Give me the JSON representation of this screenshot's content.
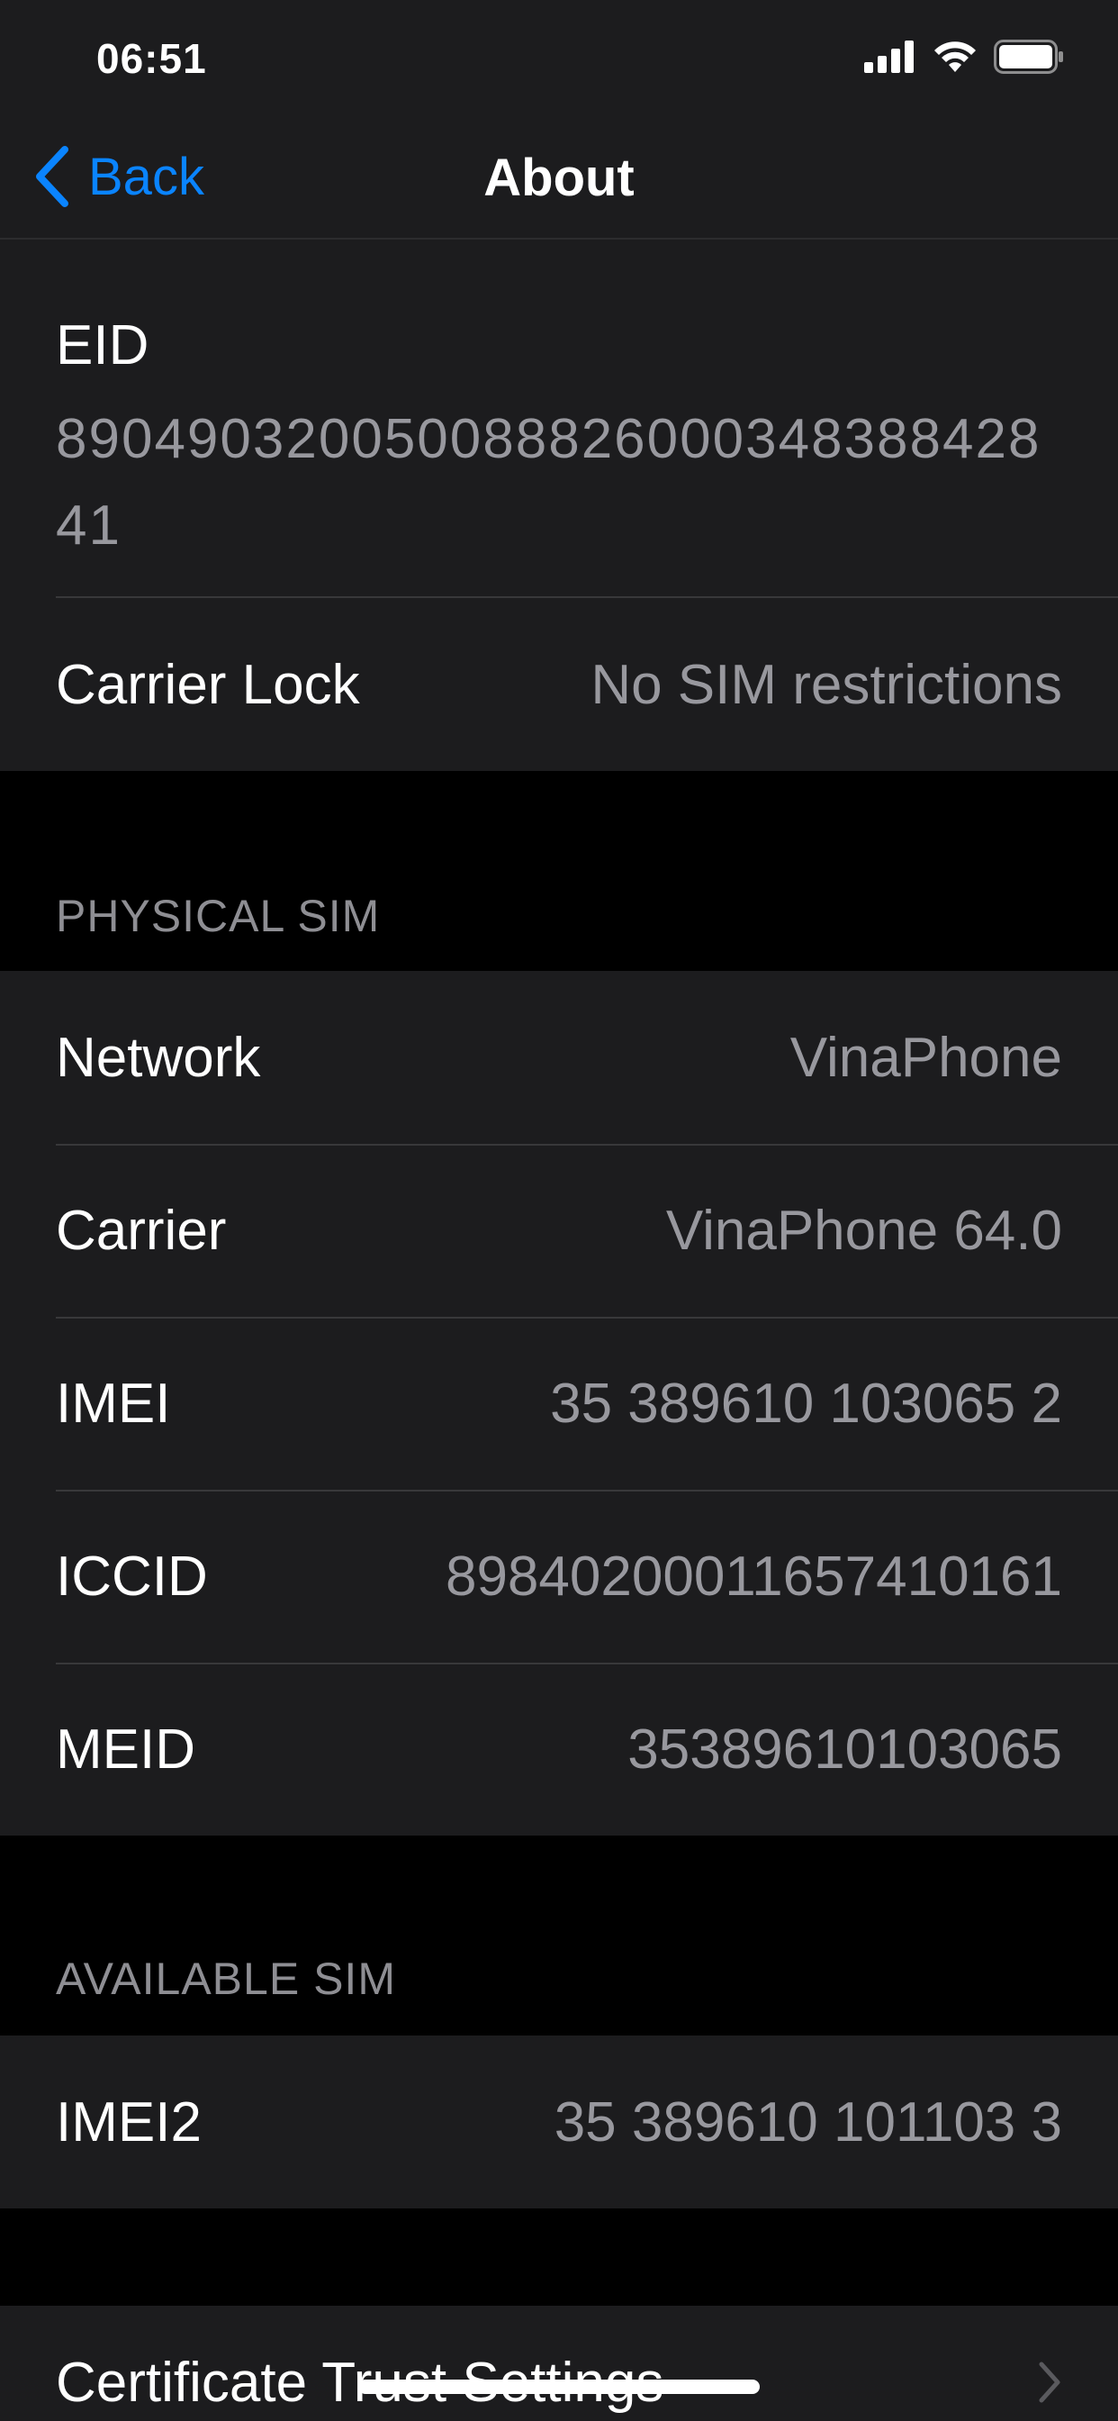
{
  "status_bar": {
    "time": "06:51",
    "icons": [
      "cellular-signal-icon",
      "wifi-icon",
      "battery-icon"
    ]
  },
  "navbar": {
    "back_label": "Back",
    "title": "About"
  },
  "eid_section": {
    "label": "EID",
    "value": "89049032005008882600034838842841"
  },
  "carrier_lock": {
    "label": "Carrier Lock",
    "value": "No SIM restrictions"
  },
  "physical_sim": {
    "header": "PHYSICAL SIM",
    "rows": [
      {
        "label": "Network",
        "value": "VinaPhone"
      },
      {
        "label": "Carrier",
        "value": "VinaPhone 64.0"
      },
      {
        "label": "IMEI",
        "value": "35 389610 103065 2"
      },
      {
        "label": "ICCID",
        "value": "89840200011657410161"
      },
      {
        "label": "MEID",
        "value": "35389610103065"
      }
    ]
  },
  "available_sim": {
    "header": "AVAILABLE SIM",
    "rows": [
      {
        "label": "IMEI2",
        "value": "35 389610 101103 3"
      }
    ]
  },
  "certificate": {
    "label": "Certificate Trust Settings"
  },
  "colors": {
    "background": "#000000",
    "cell": "#1c1c1e",
    "accent": "#0a84ff",
    "secondary_text": "#98989e"
  }
}
